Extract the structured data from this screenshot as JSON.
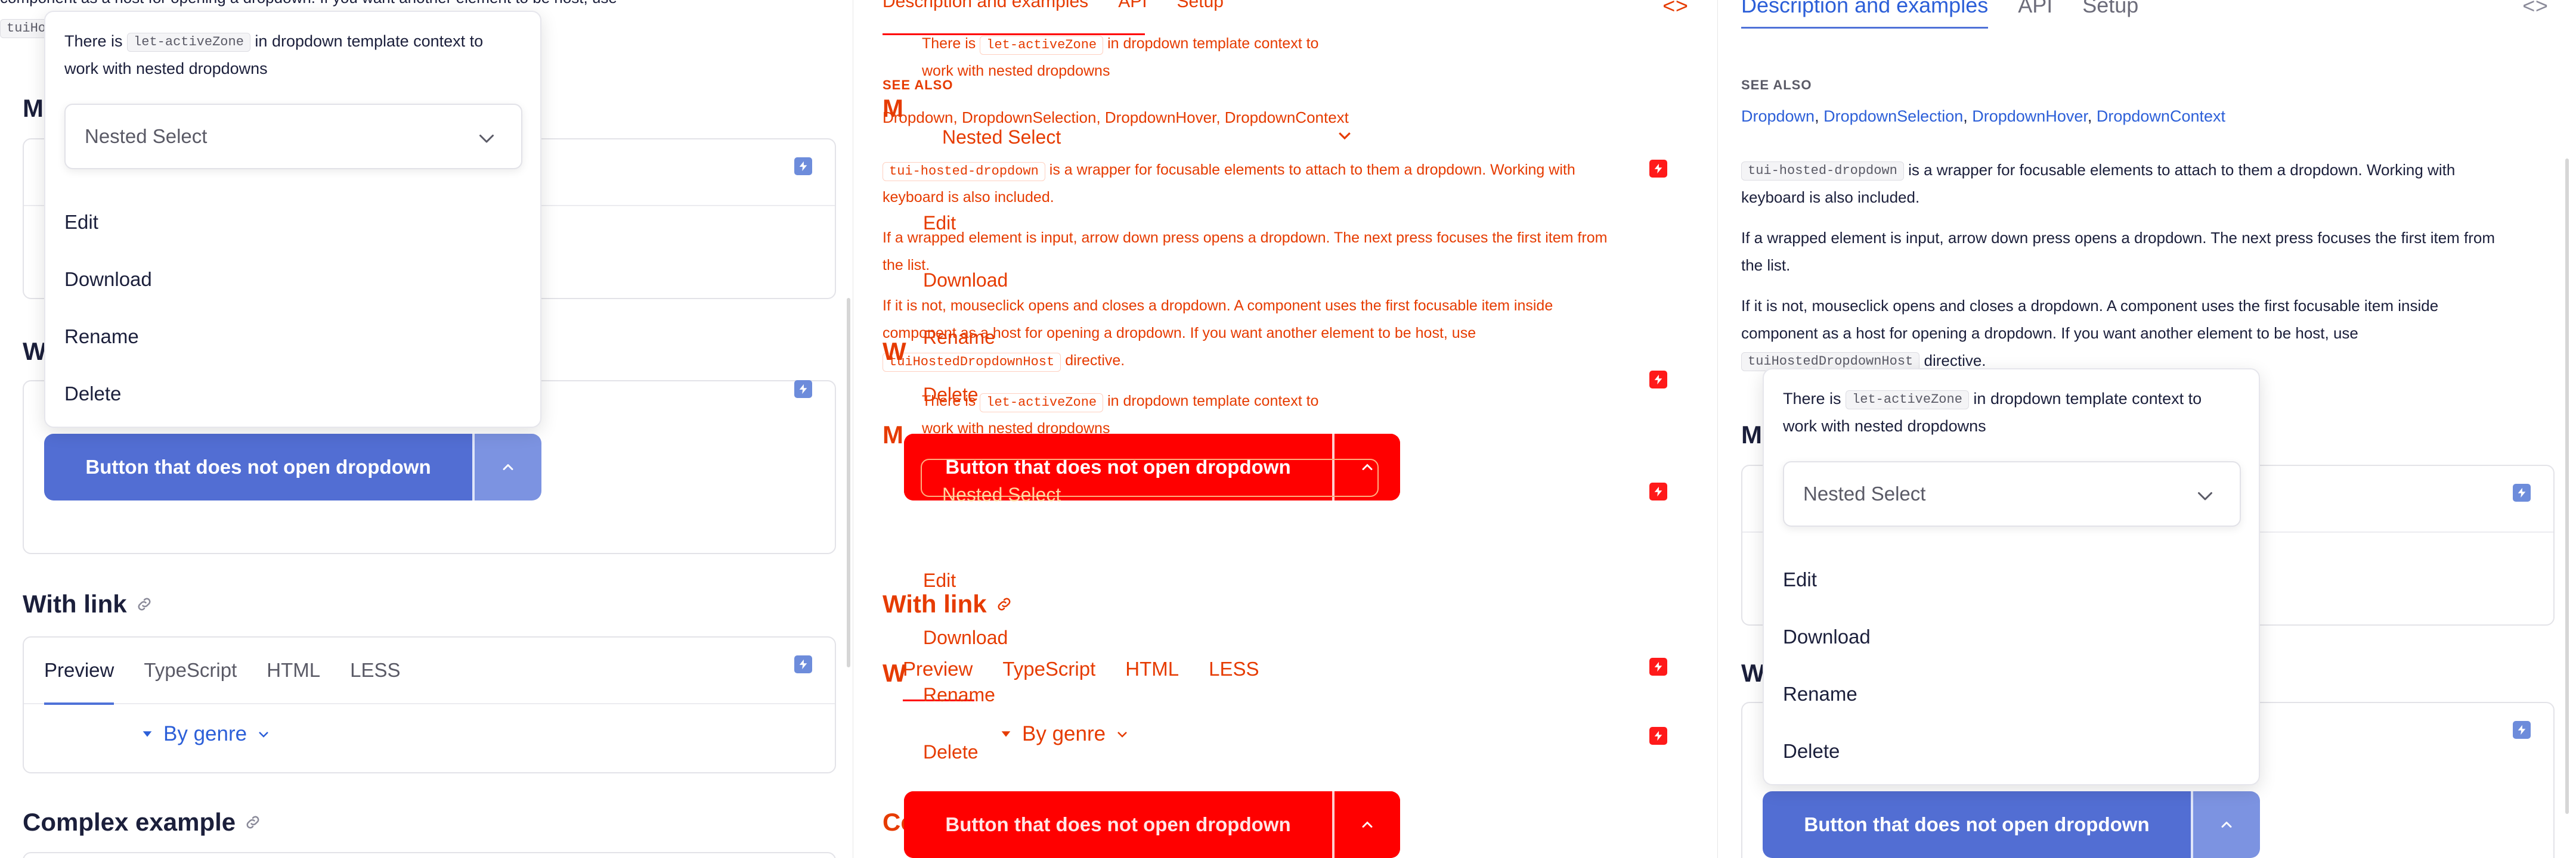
{
  "top_tabs": [
    "Description and examples",
    "API",
    "Setup"
  ],
  "code_toggle": "<>",
  "see_also": {
    "heading": "SEE ALSO",
    "links": [
      "Dropdown",
      "DropdownSelection",
      "DropdownHover",
      "DropdownContext"
    ],
    "separator": ", "
  },
  "description": {
    "host_code": "tui-hosted-dropdown",
    "host_text": "is a wrapper for focusable elements to attach to them a dropdown. Working with",
    "host_text2": "keyboard is also included.",
    "input_text": "If a wrapped element is input, arrow down press opens a dropdown. The next press focuses the first item from",
    "input_text2": "the list.",
    "click_text": "If it is not, mouseclick opens and closes a dropdown. A component uses the first focusable item inside",
    "click_text2": "component as a host for opening a dropdown. If you want another element to be host, use",
    "directive_code": "tuiHostedDropdownHost",
    "directive_text": "directive."
  },
  "dropdown": {
    "note_prefix": "There is",
    "note_code": "let-activeZone",
    "note_suffix": "in dropdown template context to",
    "note_line2": "work with nested dropdowns",
    "nested_select": "Nested Select",
    "items": [
      "Edit",
      "Download",
      "Rename",
      "Delete"
    ]
  },
  "split_button": {
    "label": "Button that does not open dropdown"
  },
  "sections": {
    "m_heading": "M",
    "w_heading": "W",
    "with_link": "With link",
    "complex": "Complex example"
  },
  "card_tabs": [
    "Preview",
    "TypeScript",
    "HTML",
    "LESS"
  ],
  "by_genre": "By genre",
  "colors": {
    "accent": "#526ed3",
    "link": "#2c5fd8",
    "overlay_red": "#ff0000",
    "overlay_text": "#e63b00"
  }
}
